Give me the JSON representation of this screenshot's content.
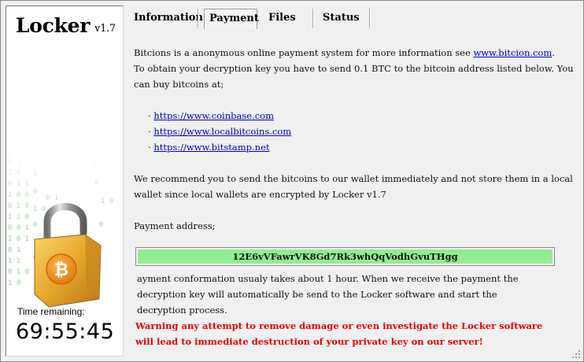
{
  "app": {
    "title": "Locker",
    "version": "v1.7",
    "time_label": "Time remaining:",
    "time_value": "69:55:45"
  },
  "tabs": [
    {
      "label": "Information",
      "active": false
    },
    {
      "label": "Payment",
      "active": true
    },
    {
      "label": "Files",
      "active": false
    },
    {
      "label": "Status",
      "active": false
    }
  ],
  "payment": {
    "intro_prefix": "Bitcions is a anonymous online payment system for more information see ",
    "intro_link": "www.bitcion.com",
    "intro_suffix": ".",
    "line2": "To obtain your decryption key you have to send 0.1 BTC to the bitcoin address listed below. You can buy bitcoins at;",
    "links": [
      "https://www.coinbase.com",
      "https://www.localbitcoins.com",
      "https://www.bitstamp.net"
    ],
    "recommend": "We recommend you to send the bitcoins to our wallet immediately and not store them in a local wallet since local wallets are encrypted by Locker v1.7",
    "address_label": "Payment address;",
    "address": "12E6vVFawrVK8Gd7Rk3whQqVodhGvuTHgg",
    "confirm_1": "ayment conformation usualy takes about 1 hour. When we receive the payment the",
    "confirm_2": "decryption key will automatically be send to the Locker software and start the",
    "confirm_3": "decryption process.",
    "warning_1": "Warning any attempt to remove damage or even investigate the Locker software",
    "warning_2": "will lead to immediate destruction of your private key on our server!"
  },
  "colors": {
    "address_bg": "#90ee90",
    "warning": "#e60000",
    "link": "#0000cc",
    "padlock_gold": "#e8a62a"
  },
  "icons": {
    "padlock": "bitcoin-padlock-icon",
    "grip": "resize-grip-icon"
  }
}
